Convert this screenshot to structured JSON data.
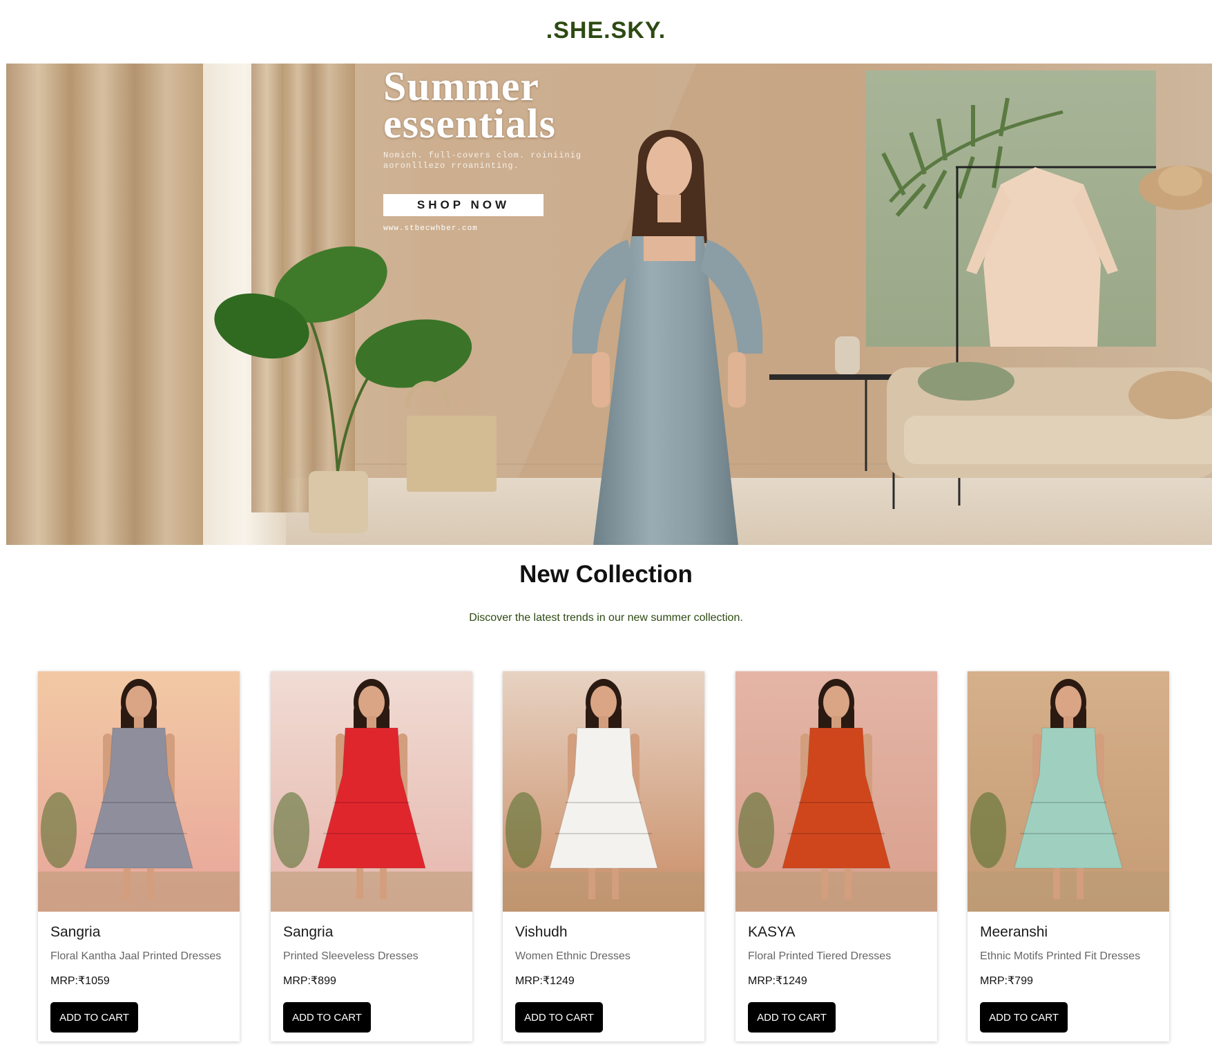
{
  "header": {
    "logo": ".SHE.SKY."
  },
  "hero": {
    "title_line1": "Summer",
    "title_line2": "essentials",
    "subtitle": "Nomich. full-covers clom. roiniinig aoronlllezo rroaninting.",
    "button_label": "SHOP NOW",
    "url_text": "www.stbecwhber.com"
  },
  "collection": {
    "title": "New Collection",
    "subtitle": "Discover the latest trends in our new summer collection."
  },
  "products": [
    {
      "brand": "Sangria",
      "description": "Floral Kantha Jaal Printed Dresses",
      "price": "MRP:₹1059",
      "button": "ADD TO CART",
      "dress_color": "#8f8e9c",
      "bg_top": "#f2c9a4",
      "bg_bottom": "#e8a59a"
    },
    {
      "brand": "Sangria",
      "description": "Printed Sleeveless Dresses",
      "price": "MRP:₹899",
      "button": "ADD TO CART",
      "dress_color": "#e0262d",
      "bg_top": "#f0dcd4",
      "bg_bottom": "#e6b6ac"
    },
    {
      "brand": "Vishudh",
      "description": "Women Ethnic Dresses",
      "price": "MRP:₹1249",
      "button": "ADD TO CART",
      "dress_color": "#f4f2ee",
      "bg_top": "#e7d2c2",
      "bg_bottom": "#c98d66"
    },
    {
      "brand": "KASYA",
      "description": "Floral Printed Tiered Dresses",
      "price": "MRP:₹1249",
      "button": "ADD TO CART",
      "dress_color": "#d0461c",
      "bg_top": "#e4b5a6",
      "bg_bottom": "#d99f8c"
    },
    {
      "brand": "Meeranshi",
      "description": "Ethnic Motifs Printed Fit Dresses",
      "price": "MRP:₹799",
      "button": "ADD TO CART",
      "dress_color": "#9fcfbf",
      "bg_top": "#d5b08a",
      "bg_bottom": "#c59b74"
    }
  ]
}
